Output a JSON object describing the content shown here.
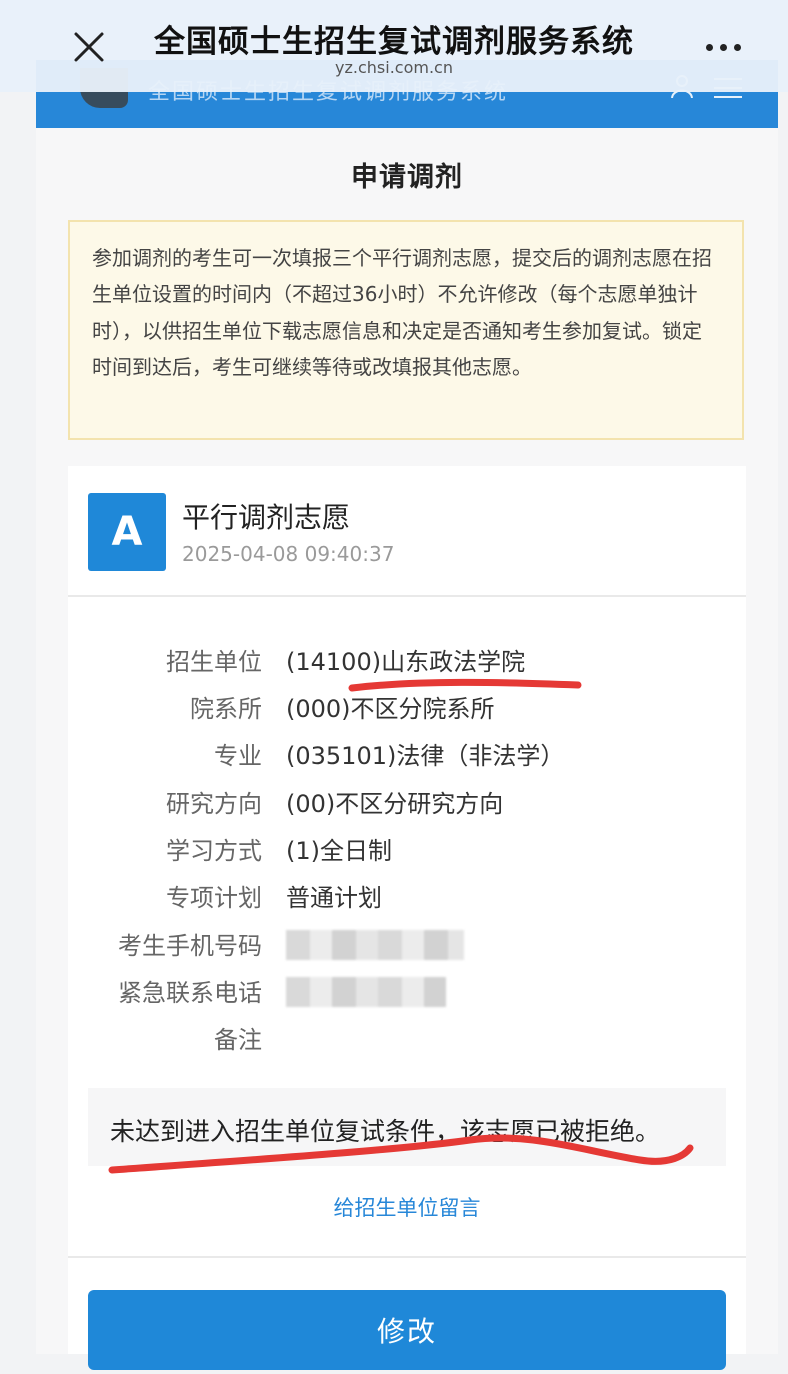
{
  "window": {
    "title": "全国硕士生招生复试调剂服务系统",
    "url": "yz.chsi.com.cn"
  },
  "site_header": {
    "name": "全国硕士生招生复试调剂服务系统"
  },
  "page": {
    "heading": "申请调剂"
  },
  "notice": {
    "text": "参加调剂的考生可一次填报三个平行调剂志愿，提交后的调剂志愿在招生单位设置的时间内（不超过36小时）不允许修改（每个志愿单独计时），以供招生单位下载志愿信息和决定是否通知考生参加复试。锁定时间到达后，考生可继续等待或改填报其他志愿。"
  },
  "card": {
    "badge": "A",
    "title": "平行调剂志愿",
    "timestamp": "2025-04-08 09:40:37",
    "fields": [
      {
        "label": "招生单位",
        "value": "(14100)山东政法学院"
      },
      {
        "label": "院系所",
        "value": "(000)不区分院系所"
      },
      {
        "label": "专业",
        "value": "(035101)法律（非法学）"
      },
      {
        "label": "研究方向",
        "value": "(00)不区分研究方向"
      },
      {
        "label": "学习方式",
        "value": "(1)全日制"
      },
      {
        "label": "专项计划",
        "value": "普通计划"
      },
      {
        "label": "考生手机号码",
        "value": ""
      },
      {
        "label": "紧急联系电话",
        "value": ""
      },
      {
        "label": "备注",
        "value": ""
      }
    ],
    "status": "未达到进入招生单位复试条件，该志愿已被拒绝。",
    "message_link": "给招生单位留言",
    "modify_button": "修改"
  },
  "colors": {
    "primary": "#1f88d8",
    "notice_bg": "#fdf9e8",
    "annotation": "#e53935"
  }
}
